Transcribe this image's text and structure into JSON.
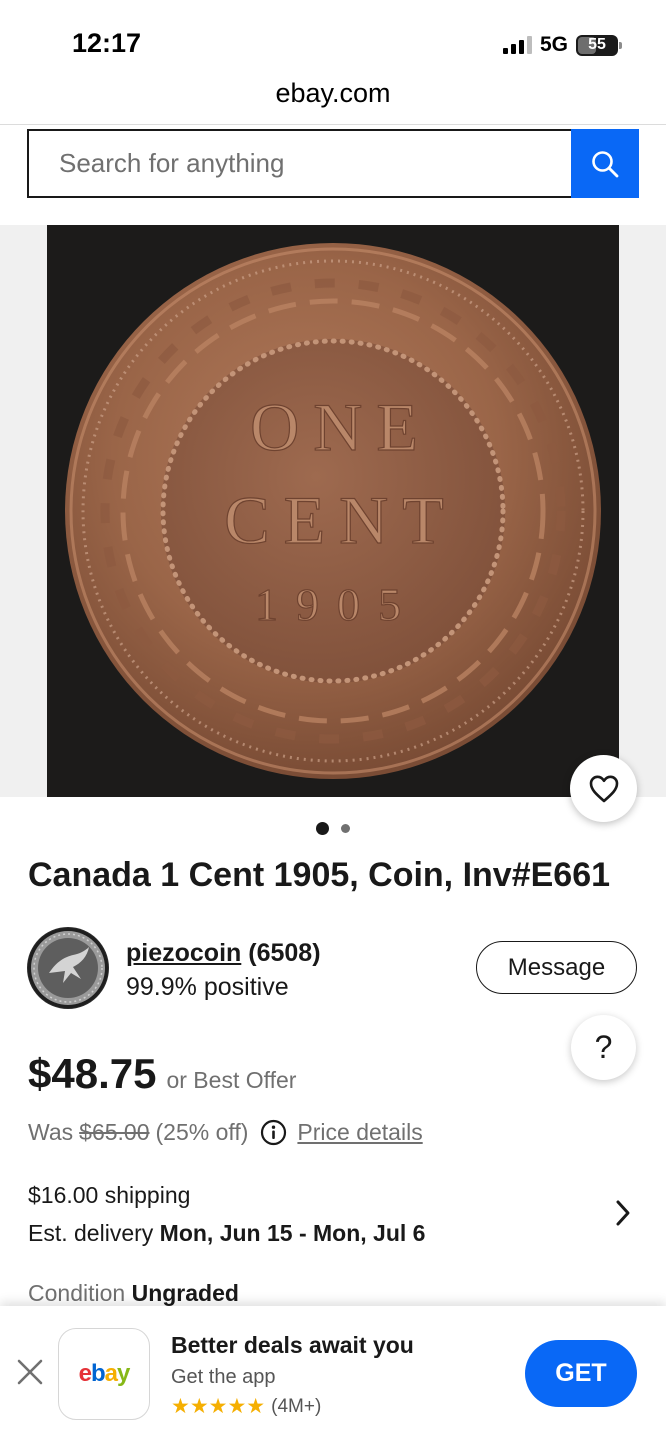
{
  "status_bar": {
    "time": "12:17",
    "network": "5G",
    "battery": "55"
  },
  "browser": {
    "url": "ebay.com"
  },
  "search": {
    "placeholder": "Search for anything"
  },
  "gallery": {
    "coin_inscription": [
      "ONE",
      "CENT",
      "1905"
    ],
    "page_dots": 2,
    "active_dot": 0
  },
  "listing": {
    "title": "Canada 1 Cent 1905, Coin, Inv#E661",
    "seller": {
      "name": "piezocoin",
      "score": "(6508)",
      "feedback": "99.9% positive"
    },
    "message_label": "Message",
    "help_label": "?",
    "price": "$48.75",
    "best_offer": "or Best Offer",
    "was_label": "Was",
    "was_price": "$65.00",
    "discount": "(25% off)",
    "price_details": "Price details",
    "shipping": "$16.00 shipping",
    "delivery_label": "Est. delivery",
    "delivery_dates": "Mon, Jun 15 - Mon, Jul 6",
    "condition_label": "Condition",
    "condition_value": "Ungraded"
  },
  "app_banner": {
    "logo_letters": [
      "e",
      "b",
      "a",
      "y"
    ],
    "logo_colors": [
      "#e53238",
      "#0064d2",
      "#f5af02",
      "#86b817"
    ],
    "headline": "Better deals await you",
    "subtitle": "Get the app",
    "stars": "★★★★★",
    "rating_count": "(4M+)",
    "get_label": "GET"
  },
  "colors": {
    "accent": "#0968f6",
    "text": "#191919",
    "muted": "#707070",
    "star": "#f5af02"
  }
}
